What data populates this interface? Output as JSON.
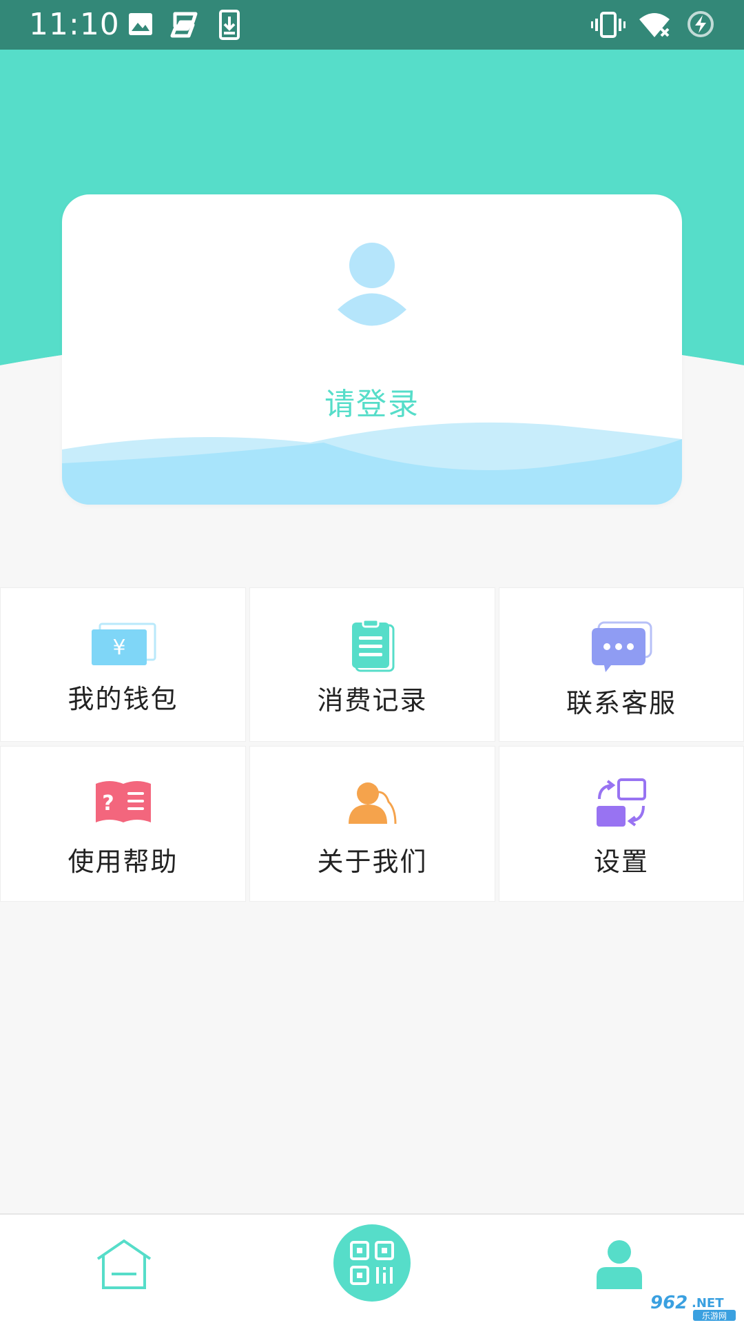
{
  "status_bar": {
    "time": "11:10",
    "icons": [
      "image-icon",
      "sogou-icon",
      "download-icon",
      "vibrate-icon",
      "wifi-off-icon",
      "battery-charging-icon"
    ]
  },
  "colors": {
    "accent": "#56ddc9",
    "status_bar": "#338878",
    "card_wave": "#a8e4fb",
    "avatar": "#b5e5fb"
  },
  "profile_card": {
    "login_label": "请登录"
  },
  "menu": [
    {
      "label": "我的钱包",
      "icon": "wallet-icon",
      "color": "#7fd6f7"
    },
    {
      "label": "消费记录",
      "icon": "clipboard-icon",
      "color": "#56ddc9"
    },
    {
      "label": "联系客服",
      "icon": "chat-icon",
      "color": "#8f9cf3"
    },
    {
      "label": "使用帮助",
      "icon": "help-book-icon",
      "color": "#f3667d"
    },
    {
      "label": "关于我们",
      "icon": "people-icon",
      "color": "#f5a34c"
    },
    {
      "label": "设置",
      "icon": "switch-settings-icon",
      "color": "#9873f2"
    }
  ],
  "bottom_nav": [
    {
      "name": "home",
      "icon": "home-icon"
    },
    {
      "name": "scan",
      "icon": "qr-code-icon"
    },
    {
      "name": "me",
      "icon": "user-icon"
    }
  ],
  "watermark": {
    "brand": "962.NET",
    "sub": "乐游网"
  }
}
